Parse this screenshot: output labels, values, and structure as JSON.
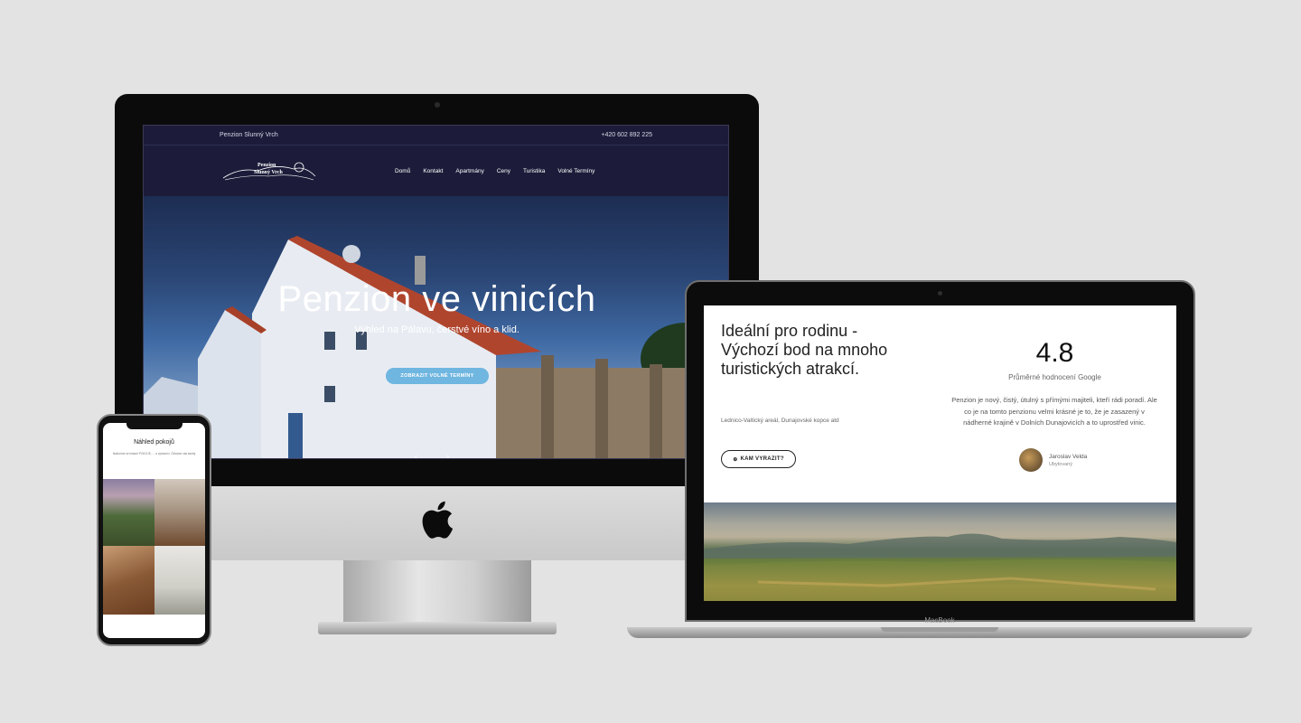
{
  "imac": {
    "topbar": {
      "brand": "Penzion Slunný Vrch",
      "phone": "+420 602 892 225"
    },
    "logo": {
      "line1": "Penzion",
      "line2": "Slunný Vrch"
    },
    "nav": [
      "Domů",
      "Kontakt",
      "Apartmány",
      "Ceny",
      "Turistika",
      "Volné Termíny"
    ],
    "hero": {
      "title": "Penzion ve vinicích",
      "subtitle": "Výhled na Pálavu, čerstvé víno a klid.",
      "button": "ZOBRAZIT VOLNÉ TERMÍNY",
      "prev": "‹",
      "next": "›"
    }
  },
  "macbook": {
    "heading": "Ideální pro rodinu - Výchozí bod na mnoho turistických atrakcí.",
    "small_text": "Lednico-Valtický areál, Dunajovské kopce atd",
    "button": "KAM VYRAZIT?",
    "rating": "4.8",
    "rating_label": "Průměrné hodnocení Google",
    "quote": "Penzion je nový, čistý, útulný s přímými majiteli, kteří rádi poradí. Ale co je na tomto penzionu velmi krásné je to, že je zasazený v nádherné krajině v Dolních Dunajovicích a to uprostřed vinic.",
    "reviewer_name": "Jaroslav Velda",
    "reviewer_role": "Ubytovaný",
    "brand_label": "MacBook"
  },
  "phone": {
    "title": "Náhled pokojů",
    "description": "Nabízíme se krásné POKOJE, ... a vybavení. Čekáme vás každý"
  }
}
